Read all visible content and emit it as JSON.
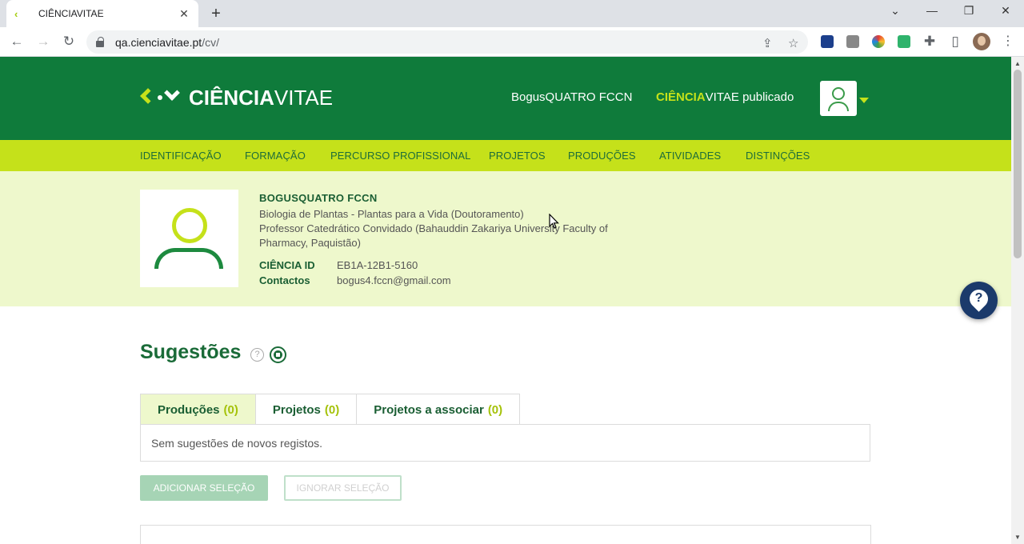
{
  "browser": {
    "tab_title": "CIÊNCIAVITAE",
    "tab_close": "✕",
    "new_tab": "+",
    "url_host": "qa.cienciavitae.pt",
    "url_path": "/cv/",
    "controls": {
      "minimize": "—",
      "restore": "❐",
      "close": "✕",
      "tab_list": "⌄"
    }
  },
  "header": {
    "logo_bold": "CIÊNCIA",
    "logo_light": "VITAE",
    "user_name": "BogusQUATRO FCCN",
    "published_bold": "CIÊNCIA",
    "published_rest": "VITAE publicado"
  },
  "nav": {
    "items": [
      "IDENTIFICAÇÃO",
      "FORMAÇÃO",
      "PERCURSO PROFISSIONAL",
      "PROJETOS",
      "PRODUÇÕES",
      "ATIVIDADES",
      "DISTINÇÕES"
    ]
  },
  "profile": {
    "name": "BOGUSQUATRO FCCN",
    "degree": "Biologia de Plantas - Plantas para a Vida (Doutoramento)",
    "position": "Professor Catedrático Convidado (Bahauddin Zakariya University Faculty of Pharmacy, Paquistão)",
    "id_label": "CIÊNCIA ID",
    "id_value": "EB1A-12B1-5160",
    "contact_label": "Contactos",
    "contact_value": "bogus4.fccn@gmail.com"
  },
  "suggestions": {
    "title": "Sugestões",
    "help": "?",
    "tabs": [
      {
        "label": "Produções",
        "count": "(0)"
      },
      {
        "label": "Projetos",
        "count": "(0)"
      },
      {
        "label": "Projetos a associar",
        "count": "(0)"
      }
    ],
    "empty_message": "Sem sugestões de novos registos.",
    "add_button": "ADICIONAR SELEÇÃO",
    "ignore_button": "IGNORAR SELEÇÃO"
  },
  "help_fab": "?",
  "colors": {
    "header_green": "#0f7b3b",
    "lime": "#c5e11a",
    "band": "#eef8cc",
    "fab_navy": "#1b3a6b"
  }
}
